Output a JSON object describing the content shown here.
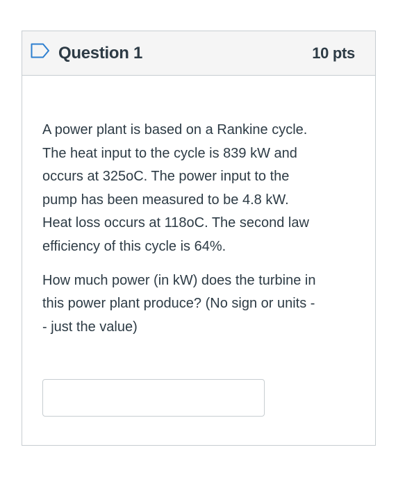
{
  "question": {
    "title": "Question 1",
    "points": "10 pts",
    "flag_icon": "flag-outline-icon",
    "paragraphs": [
      "A power plant is based on a Rankine cycle.\nThe heat input to the cycle is 839 kW and\noccurs at 325oC.  The power input to the\npump has been measured to be  4.8 kW.\nHeat loss occurs at 118oC. The second law\nefficiency of this cycle is 64%.",
      "How much power (in kW) does the turbine in\nthis power plant produce? (No sign or units -\n- just the value)"
    ],
    "answer": {
      "value": "",
      "placeholder": ""
    }
  },
  "colors": {
    "text": "#2d3b45",
    "header_bg": "#f5f5f5",
    "border": "#c7cdd1",
    "flag_accent": "#2d7fd0"
  }
}
